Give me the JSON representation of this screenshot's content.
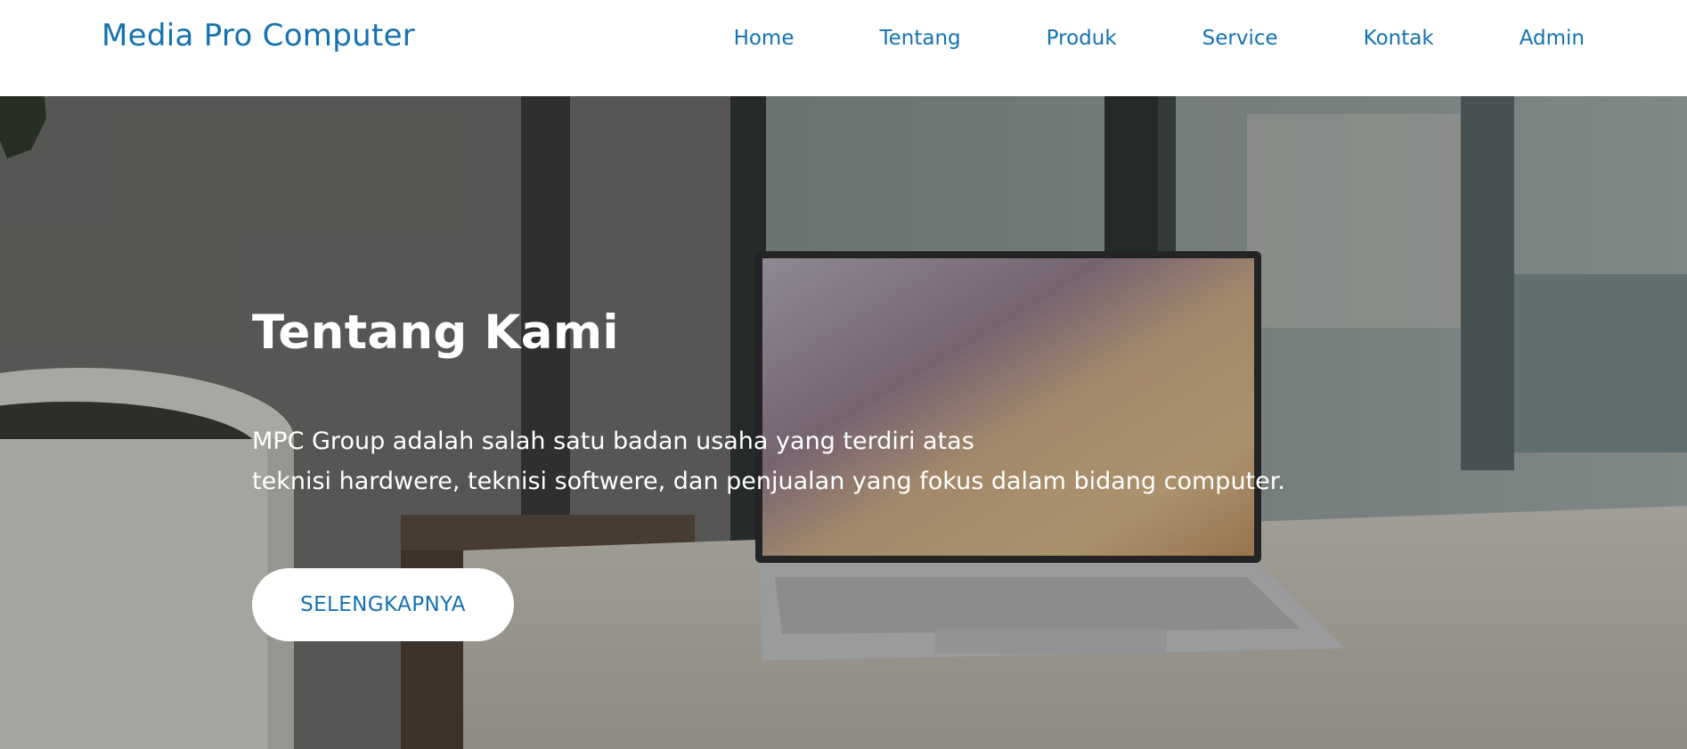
{
  "colors": {
    "accent": "#1472b0",
    "nav_background": "#ffffff",
    "hero_text": "#ffffff",
    "button_background": "#ffffff"
  },
  "header": {
    "brand": "Media Pro Computer",
    "nav": [
      {
        "label": "Home"
      },
      {
        "label": "Tentang"
      },
      {
        "label": "Produk"
      },
      {
        "label": "Service"
      },
      {
        "label": "Kontak"
      },
      {
        "label": "Admin"
      }
    ]
  },
  "hero": {
    "title": "Tentang Kami",
    "text_line_1": "MPC Group adalah salah satu badan usaha yang terdiri atas",
    "text_line_2": "teknisi hardwere, teknisi softwere, dan penjualan yang fokus dalam bidang computer.",
    "button_label": "SELENGKAPNYA"
  }
}
